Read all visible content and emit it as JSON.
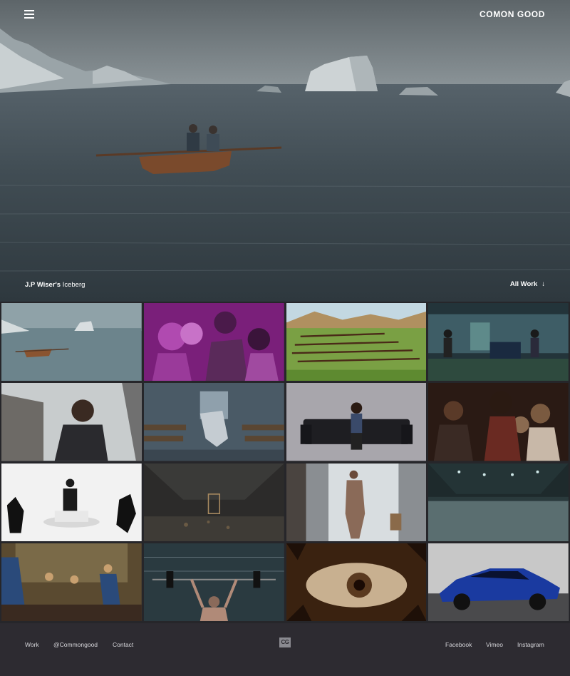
{
  "header": {
    "brand": "COMON GOOD",
    "menu_icon": "hamburger-icon"
  },
  "hero": {
    "caption_client": "J.P Wiser's",
    "caption_title": "Iceberg",
    "all_work_label": "All Work",
    "all_work_icon": "arrow-down-icon"
  },
  "grid": {
    "tiles": [
      "iceberg-rowboat",
      "purple-group",
      "landscape-field",
      "night-chase",
      "hoodie-portrait",
      "church-dancer",
      "sofa-portrait",
      "party-crowd",
      "pedestal-sculpture",
      "dark-warehouse",
      "window-figure",
      "ice-rink",
      "painted-mural",
      "weightlifter",
      "eye-illustration",
      "blue-car"
    ]
  },
  "footer": {
    "links_left": [
      "Work",
      "@Commongood",
      "Contact"
    ],
    "logo": "CG",
    "links_right": [
      "Facebook",
      "Vimeo",
      "Instagram"
    ]
  }
}
